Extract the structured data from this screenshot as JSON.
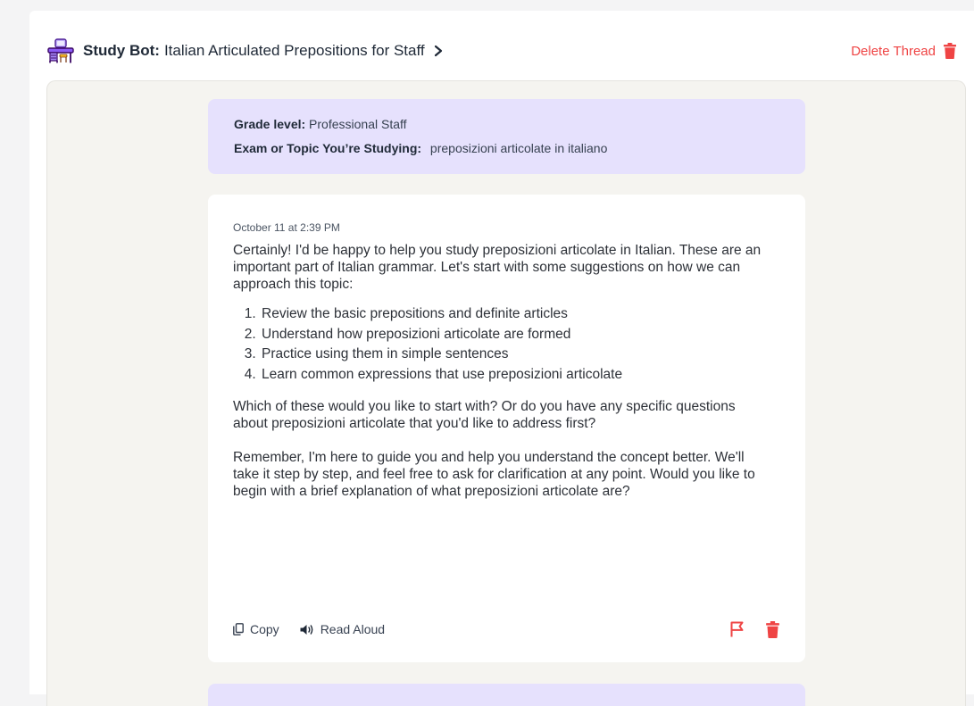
{
  "header": {
    "bot_name": "Study Bot:",
    "thread_title": "Italian Articulated Prepositions for Staff",
    "delete_thread_label": "Delete Thread"
  },
  "prompt": {
    "grade_label": "Grade level:",
    "grade_value": "Professional Staff",
    "topic_label": "Exam or Topic You’re Studying:",
    "topic_value": "preposizioni articolate in italiano"
  },
  "message": {
    "timestamp": "October 11 at 2:39 PM",
    "intro": "Certainly! I'd be happy to help you study preposizioni articolate in Italian. These are an important part of Italian grammar. Let's start with some suggestions on how we can approach this topic:",
    "list": [
      "Review the basic prepositions and definite articles",
      "Understand how preposizioni articolate are formed",
      "Practice using them in simple sentences",
      "Learn common expressions that use preposizioni articolate"
    ],
    "question": "Which of these would you like to start with? Or do you have any specific questions about preposizioni articolate that you'd like to address first?",
    "closing": "Remember, I'm here to guide you and help you understand the concept better. We'll take it step by step, and feel free to ask for clarification at any point. Would you like to begin with a brief explanation of what preposizioni articolate are?",
    "copy_label": "Copy",
    "read_aloud_label": "Read Aloud"
  },
  "colors": {
    "danger": "#ef4444",
    "prompt_bg": "#e6e1fd",
    "thread_bg": "#f5f4f0"
  },
  "icons": {
    "bot": "desk-chair-icon",
    "chevron": "chevron-right-icon",
    "delete": "trash-icon",
    "copy": "copy-icon",
    "read_aloud": "speaker-icon",
    "flag": "flag-icon"
  }
}
